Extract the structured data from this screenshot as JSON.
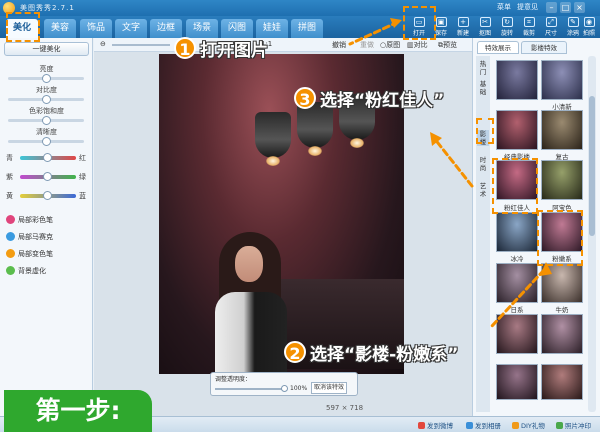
{
  "app": {
    "title": "美图秀秀2.7.1",
    "menu": [
      "菜单",
      "提意见"
    ]
  },
  "tabs": [
    {
      "label": "美化",
      "active": true
    },
    {
      "label": "美容"
    },
    {
      "label": "饰品"
    },
    {
      "label": "文字"
    },
    {
      "label": "边框"
    },
    {
      "label": "场景"
    },
    {
      "label": "闪图"
    },
    {
      "label": "娃娃"
    },
    {
      "label": "拼图"
    }
  ],
  "toolbar": [
    "打开",
    "保存",
    "新建",
    "抠图",
    "旋转",
    "裁剪",
    "尺寸",
    "涂鸦",
    "拍照"
  ],
  "left_panel": {
    "onekey": "一键美化",
    "sliders": [
      {
        "label": "亮度",
        "value": 0.5
      },
      {
        "label": "对比度",
        "value": 0.5
      },
      {
        "label": "色彩饱和度",
        "value": 0.5
      },
      {
        "label": "清晰度",
        "value": 0.5
      }
    ],
    "color_sliders": [
      {
        "left": "青",
        "right": "红"
      },
      {
        "left": "紫",
        "right": "绿"
      },
      {
        "left": "黄",
        "right": "蓝"
      }
    ],
    "tools": [
      "局部彩色笔",
      "局部马赛克",
      "局部变色笔",
      "背景虚化"
    ]
  },
  "edit_toolbar": {
    "zoom": "1:1",
    "undo": "撤销",
    "redo": "重做",
    "original": "原图",
    "compare": "对比",
    "preview": "预览"
  },
  "opacity_panel": {
    "label": "调整透明度：",
    "value": "100%",
    "cancel": "取消该特效"
  },
  "image_size": "597 × 718",
  "right_panel": {
    "tabs": [
      "特效展示",
      "影楼特效"
    ],
    "categories": [
      "热门",
      "基础",
      "影楼",
      "时尚",
      "艺术"
    ],
    "effects": [
      "小清新",
      "经典影楼",
      "复古",
      "粉红佳人",
      "阿宝色",
      "冰冷",
      "粉嫩系",
      "日系",
      "牛奶",
      "",
      "",
      "",
      ""
    ]
  },
  "status_links": [
    "发到微博",
    "发到相册",
    "DIY礼物",
    "照片冲印"
  ],
  "tutorial": {
    "step_title": "第一步:",
    "callouts": [
      {
        "num": "1",
        "text": "打开图片"
      },
      {
        "num": "3",
        "text": "选择“粉红佳人”"
      },
      {
        "num": "2",
        "text": "选择“影楼-粉嫩系”"
      }
    ],
    "accent": "#f59100",
    "step_color": "#2fa82e"
  }
}
